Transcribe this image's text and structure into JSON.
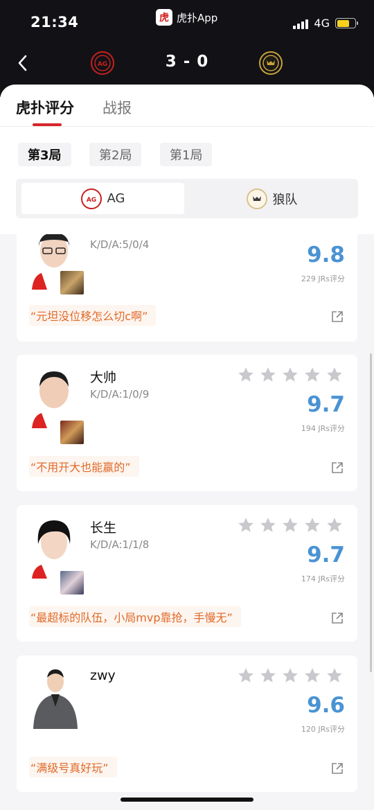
{
  "status_bar": {
    "time": "21:34",
    "network": "4G",
    "app_badge_glyph": "虎",
    "app_name": "虎扑App"
  },
  "match": {
    "score": "3 - 0",
    "left_team_logo": "AG",
    "right_team_logo": "WOLVES"
  },
  "tabs": [
    {
      "label": "虎扑评分"
    },
    {
      "label": "战报"
    }
  ],
  "games": [
    {
      "label": "第3局"
    },
    {
      "label": "第2局"
    },
    {
      "label": "第1局"
    }
  ],
  "teams": [
    {
      "name": "AG"
    },
    {
      "name": "狼队"
    }
  ],
  "players": [
    {
      "name": "",
      "kda": "K/D/A:5/0/4",
      "rating": "9.8",
      "votes": "229 JRs评分",
      "comment": "“元坦没位移怎么切c啊”",
      "stars": 0
    },
    {
      "name": "大帅",
      "kda": "K/D/A:1/0/9",
      "rating": "9.7",
      "votes": "194 JRs评分",
      "comment": "“不用开大也能赢的”",
      "stars": 0
    },
    {
      "name": "长生",
      "kda": "K/D/A:1/1/8",
      "rating": "9.7",
      "votes": "174 JRs评分",
      "comment": "“最超标的队伍，小局mvp靠抢，手慢无”",
      "stars": 0
    },
    {
      "name": "zwy",
      "kda": "",
      "rating": "9.6",
      "votes": "120 JRs评分",
      "comment": "“满级号真好玩”",
      "stars": 0
    }
  ],
  "colors": {
    "accent": "#d6252a",
    "rating": "#4a93d3",
    "comment": "#e06a2a",
    "header_bg": "#121216"
  }
}
